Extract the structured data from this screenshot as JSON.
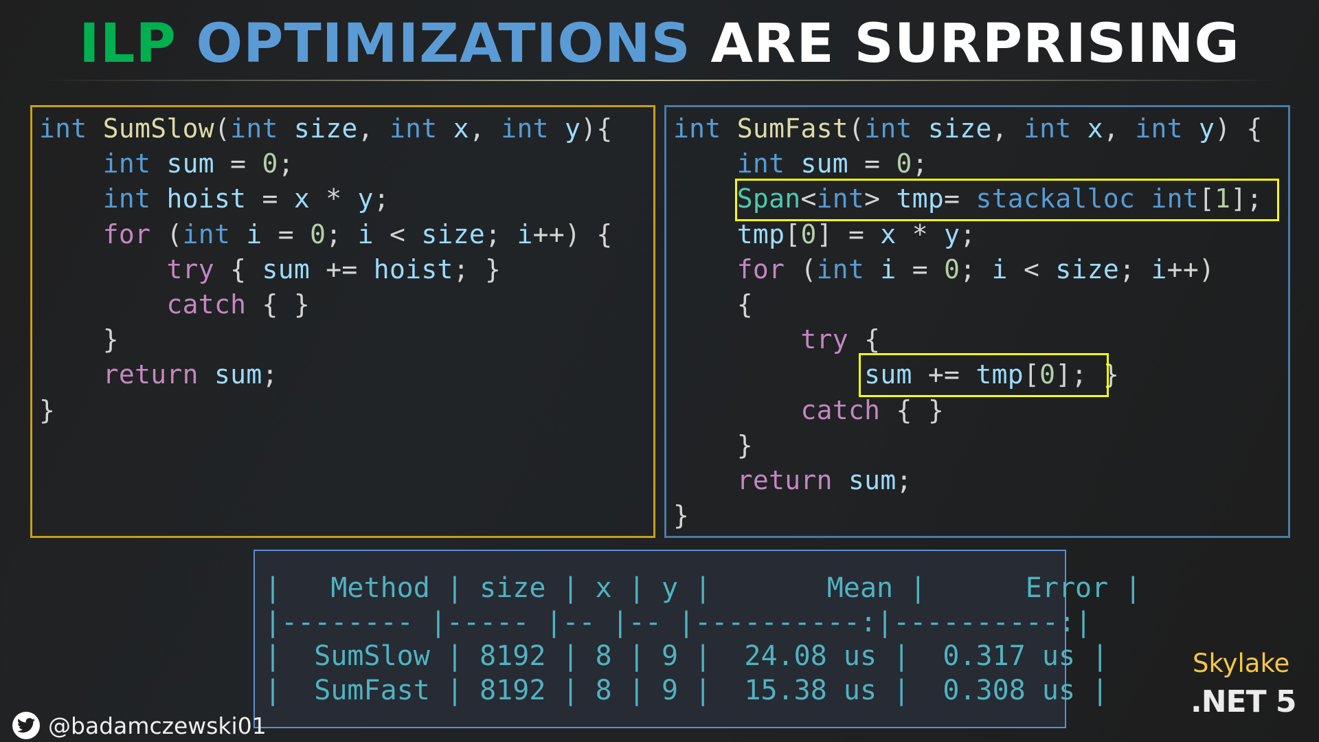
{
  "title": {
    "part1": "ILP",
    "part2": "OPTIMIZATIONS",
    "part3": "ARE SURPRISING",
    "colors": {
      "part1": "#00b050",
      "part2": "#5b9bd5",
      "part3": "#ffffff"
    }
  },
  "left_code": {
    "function_name": "SumSlow",
    "border_color": "#c9a014",
    "lines": [
      [
        [
          "kw",
          "int"
        ],
        [
          "punc",
          " "
        ],
        [
          "fn",
          "SumSlow"
        ],
        [
          "punc",
          "("
        ],
        [
          "kw",
          "int"
        ],
        [
          "punc",
          " "
        ],
        [
          "var",
          "size"
        ],
        [
          "punc",
          ", "
        ],
        [
          "kw",
          "int"
        ],
        [
          "punc",
          " "
        ],
        [
          "var",
          "x"
        ],
        [
          "punc",
          ", "
        ],
        [
          "kw",
          "int"
        ],
        [
          "punc",
          " "
        ],
        [
          "var",
          "y"
        ],
        [
          "punc",
          "){"
        ]
      ],
      [
        [
          "punc",
          "    "
        ],
        [
          "kw",
          "int"
        ],
        [
          "punc",
          " "
        ],
        [
          "var",
          "sum"
        ],
        [
          "punc",
          " = "
        ],
        [
          "num",
          "0"
        ],
        [
          "punc",
          ";"
        ]
      ],
      [
        [
          "punc",
          "    "
        ],
        [
          "kw",
          "int"
        ],
        [
          "punc",
          " "
        ],
        [
          "var",
          "hoist"
        ],
        [
          "punc",
          " = "
        ],
        [
          "var",
          "x"
        ],
        [
          "punc",
          " * "
        ],
        [
          "var",
          "y"
        ],
        [
          "punc",
          ";"
        ]
      ],
      [
        [
          "punc",
          "    "
        ],
        [
          "ctl",
          "for"
        ],
        [
          "punc",
          " ("
        ],
        [
          "kw",
          "int"
        ],
        [
          "punc",
          " "
        ],
        [
          "var",
          "i"
        ],
        [
          "punc",
          " = "
        ],
        [
          "num",
          "0"
        ],
        [
          "punc",
          "; "
        ],
        [
          "var",
          "i"
        ],
        [
          "punc",
          " < "
        ],
        [
          "var",
          "size"
        ],
        [
          "punc",
          "; "
        ],
        [
          "var",
          "i"
        ],
        [
          "punc",
          "++) {"
        ]
      ],
      [
        [
          "punc",
          "        "
        ],
        [
          "ctl",
          "try"
        ],
        [
          "punc",
          " { "
        ],
        [
          "var",
          "sum"
        ],
        [
          "punc",
          " += "
        ],
        [
          "var",
          "hoist"
        ],
        [
          "punc",
          "; }"
        ]
      ],
      [
        [
          "punc",
          "        "
        ],
        [
          "ctl",
          "catch"
        ],
        [
          "punc",
          " { }"
        ]
      ],
      [
        [
          "punc",
          "    }"
        ]
      ],
      [
        [
          "punc",
          "    "
        ],
        [
          "ctl",
          "return"
        ],
        [
          "punc",
          " "
        ],
        [
          "var",
          "sum"
        ],
        [
          "punc",
          ";"
        ]
      ],
      [
        [
          "punc",
          "}"
        ]
      ]
    ]
  },
  "right_code": {
    "function_name": "SumFast",
    "border_color": "#4a7ba8",
    "highlight_color": "#ffff00",
    "lines": [
      [
        [
          "kw",
          "int"
        ],
        [
          "punc",
          " "
        ],
        [
          "fn",
          "SumFast"
        ],
        [
          "punc",
          "("
        ],
        [
          "kw",
          "int"
        ],
        [
          "punc",
          " "
        ],
        [
          "var",
          "size"
        ],
        [
          "punc",
          ", "
        ],
        [
          "kw",
          "int"
        ],
        [
          "punc",
          " "
        ],
        [
          "var",
          "x"
        ],
        [
          "punc",
          ", "
        ],
        [
          "kw",
          "int"
        ],
        [
          "punc",
          " "
        ],
        [
          "var",
          "y"
        ],
        [
          "punc",
          ") {"
        ]
      ],
      [
        [
          "punc",
          "    "
        ],
        [
          "kw",
          "int"
        ],
        [
          "punc",
          " "
        ],
        [
          "var",
          "sum"
        ],
        [
          "punc",
          " = "
        ],
        [
          "num",
          "0"
        ],
        [
          "punc",
          ";"
        ]
      ],
      [
        [
          "punc",
          "    "
        ],
        [
          "typ",
          "Span"
        ],
        [
          "punc",
          "<"
        ],
        [
          "kw",
          "int"
        ],
        [
          "punc",
          "> "
        ],
        [
          "var",
          "tmp"
        ],
        [
          "punc",
          "= "
        ],
        [
          "kw",
          "stackalloc"
        ],
        [
          "punc",
          " "
        ],
        [
          "kw",
          "int"
        ],
        [
          "punc",
          "["
        ],
        [
          "num",
          "1"
        ],
        [
          "punc",
          "];"
        ]
      ],
      [
        [
          "punc",
          "    "
        ],
        [
          "var",
          "tmp"
        ],
        [
          "punc",
          "["
        ],
        [
          "num",
          "0"
        ],
        [
          "punc",
          "] = "
        ],
        [
          "var",
          "x"
        ],
        [
          "punc",
          " * "
        ],
        [
          "var",
          "y"
        ],
        [
          "punc",
          ";"
        ]
      ],
      [
        [
          "punc",
          "    "
        ],
        [
          "ctl",
          "for"
        ],
        [
          "punc",
          " ("
        ],
        [
          "kw",
          "int"
        ],
        [
          "punc",
          " "
        ],
        [
          "var",
          "i"
        ],
        [
          "punc",
          " = "
        ],
        [
          "num",
          "0"
        ],
        [
          "punc",
          "; "
        ],
        [
          "var",
          "i"
        ],
        [
          "punc",
          " < "
        ],
        [
          "var",
          "size"
        ],
        [
          "punc",
          "; "
        ],
        [
          "var",
          "i"
        ],
        [
          "punc",
          "++)"
        ]
      ],
      [
        [
          "punc",
          "    {"
        ]
      ],
      [
        [
          "punc",
          "        "
        ],
        [
          "ctl",
          "try"
        ],
        [
          "punc",
          " {"
        ]
      ],
      [
        [
          "punc",
          "            "
        ],
        [
          "var",
          "sum"
        ],
        [
          "punc",
          " += "
        ],
        [
          "var",
          "tmp"
        ],
        [
          "punc",
          "["
        ],
        [
          "num",
          "0"
        ],
        [
          "punc",
          "]; }"
        ]
      ],
      [
        [
          "punc",
          "        "
        ],
        [
          "ctl",
          "catch"
        ],
        [
          "punc",
          " { }"
        ]
      ],
      [
        [
          "punc",
          "    }"
        ]
      ],
      [
        [
          "punc",
          "    "
        ],
        [
          "ctl",
          "return"
        ],
        [
          "punc",
          " "
        ],
        [
          "var",
          "sum"
        ],
        [
          "punc",
          ";"
        ]
      ],
      [
        [
          "punc",
          "}"
        ]
      ]
    ]
  },
  "benchmark_table": {
    "text_color": "#4fb3c2",
    "columns": [
      "Method",
      "size",
      "x",
      "y",
      "Mean",
      "Error"
    ],
    "rows": [
      {
        "Method": "SumSlow",
        "size": "8192",
        "x": "8",
        "y": "9",
        "Mean": "24.08 us",
        "Error": "0.317 us"
      },
      {
        "Method": "SumFast",
        "size": "8192",
        "x": "8",
        "y": "9",
        "Mean": "15.38 us",
        "Error": "0.308 us"
      }
    ],
    "lines": [
      "|   Method | size | x | y |       Mean |      Error |",
      "|-------- |----- |-- |-- |----------:|----------:|",
      "|  SumSlow | 8192 | 8 | 9 |  24.08 us |  0.317 us |",
      "|  SumFast | 8192 | 8 | 9 |  15.38 us |  0.308 us |"
    ]
  },
  "footer": {
    "twitter_icon": "twitter-bird-icon",
    "handle": "@badamczewski01",
    "cpu": "Skylake",
    "runtime": ".NET 5",
    "cpu_color": "#f6c747"
  }
}
